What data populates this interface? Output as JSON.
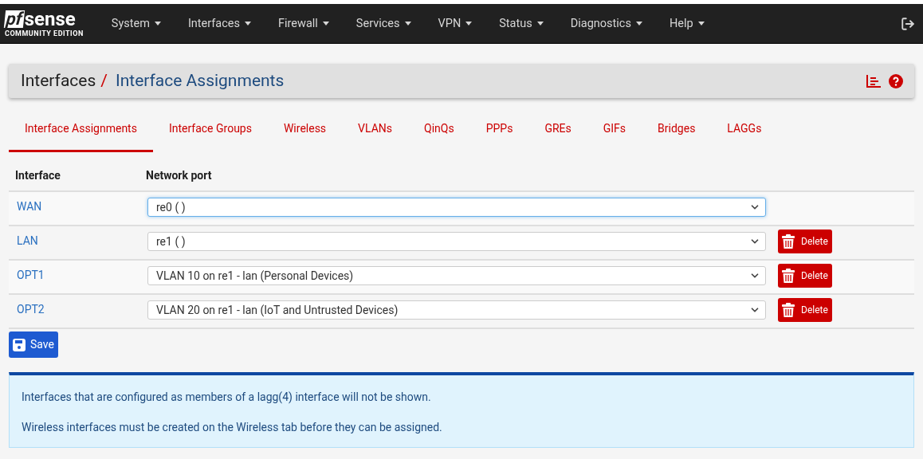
{
  "navbar": {
    "logo": {
      "brand": "sense",
      "brand_mark": "pf",
      "edition": "COMMUNITY EDITION"
    },
    "menu": [
      {
        "label": "System"
      },
      {
        "label": "Interfaces"
      },
      {
        "label": "Firewall"
      },
      {
        "label": "Services"
      },
      {
        "label": "VPN"
      },
      {
        "label": "Status"
      },
      {
        "label": "Diagnostics"
      },
      {
        "label": "Help"
      }
    ]
  },
  "breadcrumb": {
    "parent": "Interfaces",
    "separator": "/",
    "current": "Interface Assignments"
  },
  "tabs": [
    {
      "label": "Interface Assignments",
      "selected": true
    },
    {
      "label": "Interface Groups",
      "selected": false
    },
    {
      "label": "Wireless",
      "selected": false
    },
    {
      "label": "VLANs",
      "selected": false
    },
    {
      "label": "QinQs",
      "selected": false
    },
    {
      "label": "PPPs",
      "selected": false
    },
    {
      "label": "GREs",
      "selected": false
    },
    {
      "label": "GIFs",
      "selected": false
    },
    {
      "label": "Bridges",
      "selected": false
    },
    {
      "label": "LAGGs",
      "selected": false
    }
  ],
  "table": {
    "columns": [
      "Interface",
      "Network port"
    ],
    "rows": [
      {
        "interface": "WAN",
        "port": "re0 ( )",
        "focused": true
      },
      {
        "interface": "LAN",
        "port": "re1 ( )",
        "focused": false,
        "action": "Delete"
      },
      {
        "interface": "OPT1",
        "port": "VLAN 10 on re1 - lan (Personal Devices)",
        "focused": false,
        "action": "Delete"
      },
      {
        "interface": "OPT2",
        "port": "VLAN 20 on re1 - lan (IoT and Untrusted Devices)",
        "focused": false,
        "action": "Delete"
      }
    ]
  },
  "save_button": "Save",
  "info": [
    "Interfaces that are configured as members of a lagg(4) interface will not be shown.",
    "Wireless interfaces must be created on the Wireless tab before they can be assigned."
  ]
}
